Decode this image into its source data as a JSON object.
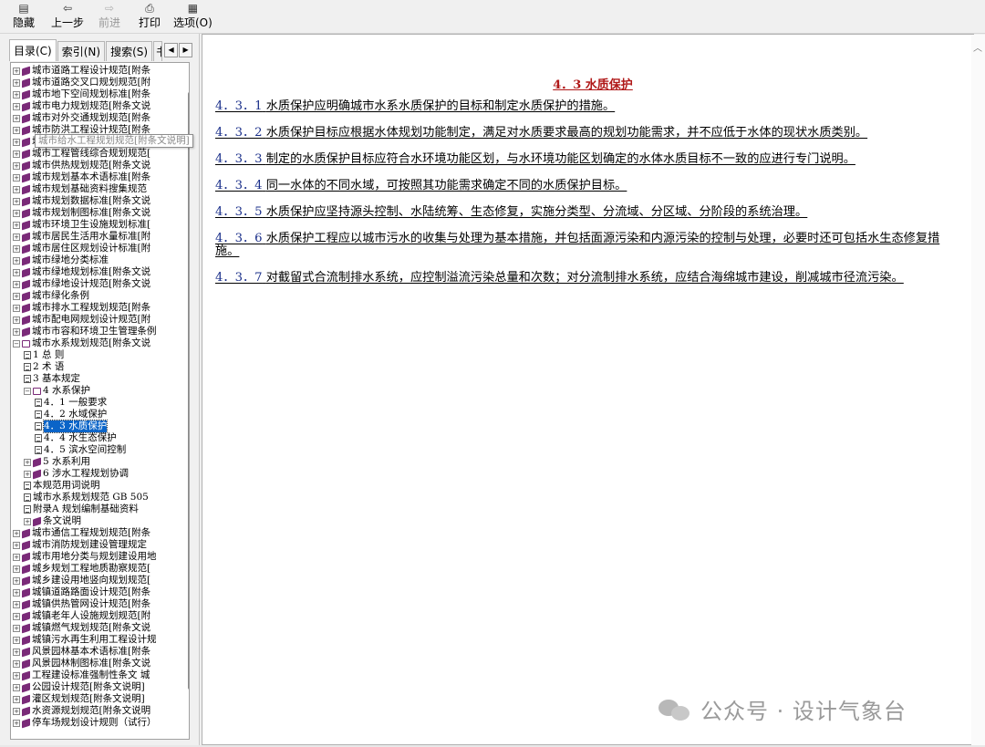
{
  "toolbar": {
    "hide": {
      "icon": "hide-pane-icon",
      "label": "隐藏"
    },
    "back": {
      "icon": "back-arrow-icon",
      "label": "上一步"
    },
    "forward": {
      "icon": "forward-arrow-icon",
      "label": "前进"
    },
    "print": {
      "icon": "printer-icon",
      "label": "打印"
    },
    "options": {
      "icon": "options-icon",
      "label": "选项(O)"
    }
  },
  "tabs": [
    "目录(C)",
    "索引(N)",
    "搜索(S)",
    "书"
  ],
  "tree": [
    {
      "t": "城市道路工程设计规范[附条",
      "k": "book",
      "l": 0,
      "tg": "+"
    },
    {
      "t": "城市道路交叉口规划规范[附",
      "k": "book",
      "l": 0,
      "tg": "+"
    },
    {
      "t": "城市地下空间规划标准[附条",
      "k": "book",
      "l": 0,
      "tg": "+"
    },
    {
      "t": "城市电力规划规范[附条文说",
      "k": "book",
      "l": 0,
      "tg": "+"
    },
    {
      "t": "城市对外交通规划规范[附条",
      "k": "book",
      "l": 0,
      "tg": "+"
    },
    {
      "t": "城市防洪工程设计规范[附条",
      "k": "book",
      "l": 0,
      "tg": "+"
    },
    {
      "t": "城市给水工程规划规范[附条",
      "k": "book",
      "l": 0,
      "tg": "+"
    },
    {
      "t": "城市工程管线综合规划规范[",
      "k": "book",
      "l": 0,
      "tg": "+"
    },
    {
      "t": "城市供热规划规范[附条文说",
      "k": "book",
      "l": 0,
      "tg": "+"
    },
    {
      "t": "城市规划基本术语标准[附条",
      "k": "book",
      "l": 0,
      "tg": "+"
    },
    {
      "t": "城市规划基础资料搜集规范",
      "k": "book",
      "l": 0,
      "tg": "+"
    },
    {
      "t": "城市规划数据标准[附条文说",
      "k": "book",
      "l": 0,
      "tg": "+"
    },
    {
      "t": "城市规划制图标准[附条文说",
      "k": "book",
      "l": 0,
      "tg": "+"
    },
    {
      "t": "城市环境卫生设施规划标准[",
      "k": "book",
      "l": 0,
      "tg": "+"
    },
    {
      "t": "城市居民生活用水量标准[附",
      "k": "book",
      "l": 0,
      "tg": "+"
    },
    {
      "t": "城市居住区规划设计标准[附",
      "k": "book",
      "l": 0,
      "tg": "+"
    },
    {
      "t": "城市绿地分类标准",
      "k": "book",
      "l": 0,
      "tg": "+"
    },
    {
      "t": "城市绿地规划标准[附条文说",
      "k": "book",
      "l": 0,
      "tg": "+"
    },
    {
      "t": "城市绿地设计规范[附条文说",
      "k": "book",
      "l": 0,
      "tg": "+"
    },
    {
      "t": "城市绿化条例",
      "k": "book",
      "l": 0,
      "tg": "+"
    },
    {
      "t": "城市排水工程规划规范[附条",
      "k": "book",
      "l": 0,
      "tg": "+"
    },
    {
      "t": "城市配电网规划设计规范[附",
      "k": "book",
      "l": 0,
      "tg": "+"
    },
    {
      "t": "城市市容和环境卫生管理条例",
      "k": "book",
      "l": 0,
      "tg": "+"
    },
    {
      "t": "城市水系规划规范[附条文说",
      "k": "open",
      "l": 0,
      "tg": "-"
    },
    {
      "t": "1 总 则",
      "k": "doc",
      "l": 1,
      "tg": ""
    },
    {
      "t": "2 术 语",
      "k": "doc",
      "l": 1,
      "tg": ""
    },
    {
      "t": "3 基本规定",
      "k": "doc",
      "l": 1,
      "tg": ""
    },
    {
      "t": "4 水系保护",
      "k": "open",
      "l": 1,
      "tg": "-"
    },
    {
      "t": "4．1 一般要求",
      "k": "doc",
      "l": 2,
      "tg": ""
    },
    {
      "t": "4．2 水域保护",
      "k": "doc",
      "l": 2,
      "tg": ""
    },
    {
      "t": "4．3 水质保护",
      "k": "doc",
      "l": 2,
      "tg": "",
      "sel": true
    },
    {
      "t": "4．4 水生态保护",
      "k": "doc",
      "l": 2,
      "tg": ""
    },
    {
      "t": "4．5 滨水空间控制",
      "k": "doc",
      "l": 2,
      "tg": ""
    },
    {
      "t": "5 水系利用",
      "k": "book",
      "l": 1,
      "tg": "+"
    },
    {
      "t": "6 涉水工程规划协调",
      "k": "book",
      "l": 1,
      "tg": "+"
    },
    {
      "t": "本规范用词说明",
      "k": "doc",
      "l": 1,
      "tg": ""
    },
    {
      "t": "城市水系规划规范 GB 505",
      "k": "doc",
      "l": 1,
      "tg": ""
    },
    {
      "t": "附录A 规划编制基础资料",
      "k": "doc",
      "l": 1,
      "tg": ""
    },
    {
      "t": "条文说明",
      "k": "book",
      "l": 1,
      "tg": "+"
    },
    {
      "t": "城市通信工程规划规范[附条",
      "k": "book",
      "l": 0,
      "tg": "+"
    },
    {
      "t": "城市消防规划建设管理规定",
      "k": "book",
      "l": 0,
      "tg": "+"
    },
    {
      "t": "城市用地分类与规划建设用地",
      "k": "book",
      "l": 0,
      "tg": "+"
    },
    {
      "t": "城乡规划工程地质勘察规范[",
      "k": "book",
      "l": 0,
      "tg": "+"
    },
    {
      "t": "城乡建设用地竖向规划规范[",
      "k": "book",
      "l": 0,
      "tg": "+"
    },
    {
      "t": "城镇道路路面设计规范[附条",
      "k": "book",
      "l": 0,
      "tg": "+"
    },
    {
      "t": "城镇供热管网设计规范[附条",
      "k": "book",
      "l": 0,
      "tg": "+"
    },
    {
      "t": "城镇老年人设施规划规范[附",
      "k": "book",
      "l": 0,
      "tg": "+"
    },
    {
      "t": "城镇燃气规划规范[附条文说",
      "k": "book",
      "l": 0,
      "tg": "+"
    },
    {
      "t": "城镇污水再生利用工程设计规",
      "k": "book",
      "l": 0,
      "tg": "+"
    },
    {
      "t": "风景园林基本术语标准[附条",
      "k": "book",
      "l": 0,
      "tg": "+"
    },
    {
      "t": "风景园林制图标准[附条文说",
      "k": "book",
      "l": 0,
      "tg": "+"
    },
    {
      "t": "工程建设标准强制性条文 城",
      "k": "book",
      "l": 0,
      "tg": "+"
    },
    {
      "t": "公园设计规范[附条文说明]",
      "k": "book",
      "l": 0,
      "tg": "+"
    },
    {
      "t": "灌区规划规范[附条文说明]",
      "k": "book",
      "l": 0,
      "tg": "+"
    },
    {
      "t": "水资源规划规范[附条文说明",
      "k": "book",
      "l": 0,
      "tg": "+"
    },
    {
      "t": "停车场规划设计规则（试行）",
      "k": "book",
      "l": 0,
      "tg": "+"
    }
  ],
  "tooltip": "城市给水工程规划规范[附条文说明]",
  "document": {
    "title": "4．3 水质保护",
    "paragraphs": [
      {
        "num": "4．3．1",
        "text": "水质保护应明确城市水系水质保护的目标和制定水质保护的措施。"
      },
      {
        "num": "4．3．2",
        "text": "水质保护目标应根据水体规划功能制定，满足对水质要求最高的规划功能需求，并不应低于水体的现状水质类别。"
      },
      {
        "num": "4．3．3",
        "text": "制定的水质保护目标应符合水环境功能区划，与水环境功能区划确定的水体水质目标不一致的应进行专门说明。"
      },
      {
        "num": "4．3．4",
        "text": "同一水体的不同水域，可按照其功能需求确定不同的水质保护目标。"
      },
      {
        "num": "4．3．5",
        "text": "水质保护应坚持源头控制、水陆统筹、生态修复，实施分类型、分流域、分区域、分阶段的系统治理。"
      },
      {
        "num": "4．3．6",
        "text": "水质保护工程应以城市污水的收集与处理为基本措施，并包括面源污染和内源污染的控制与处理，必要时还可包括水生态修复措施。"
      },
      {
        "num": "4．3．7",
        "text": "对截留式合流制排水系统，应控制溢流污染总量和次数；对分流制排水系统，应结合海绵城市建设，削减城市径流污染。"
      }
    ]
  },
  "watermark": "公众号 · 设计气象台",
  "colors": {
    "selection": "#0a64c8",
    "title": "#b01818",
    "number": "#1a2f8a",
    "book": "#7a2a78"
  }
}
